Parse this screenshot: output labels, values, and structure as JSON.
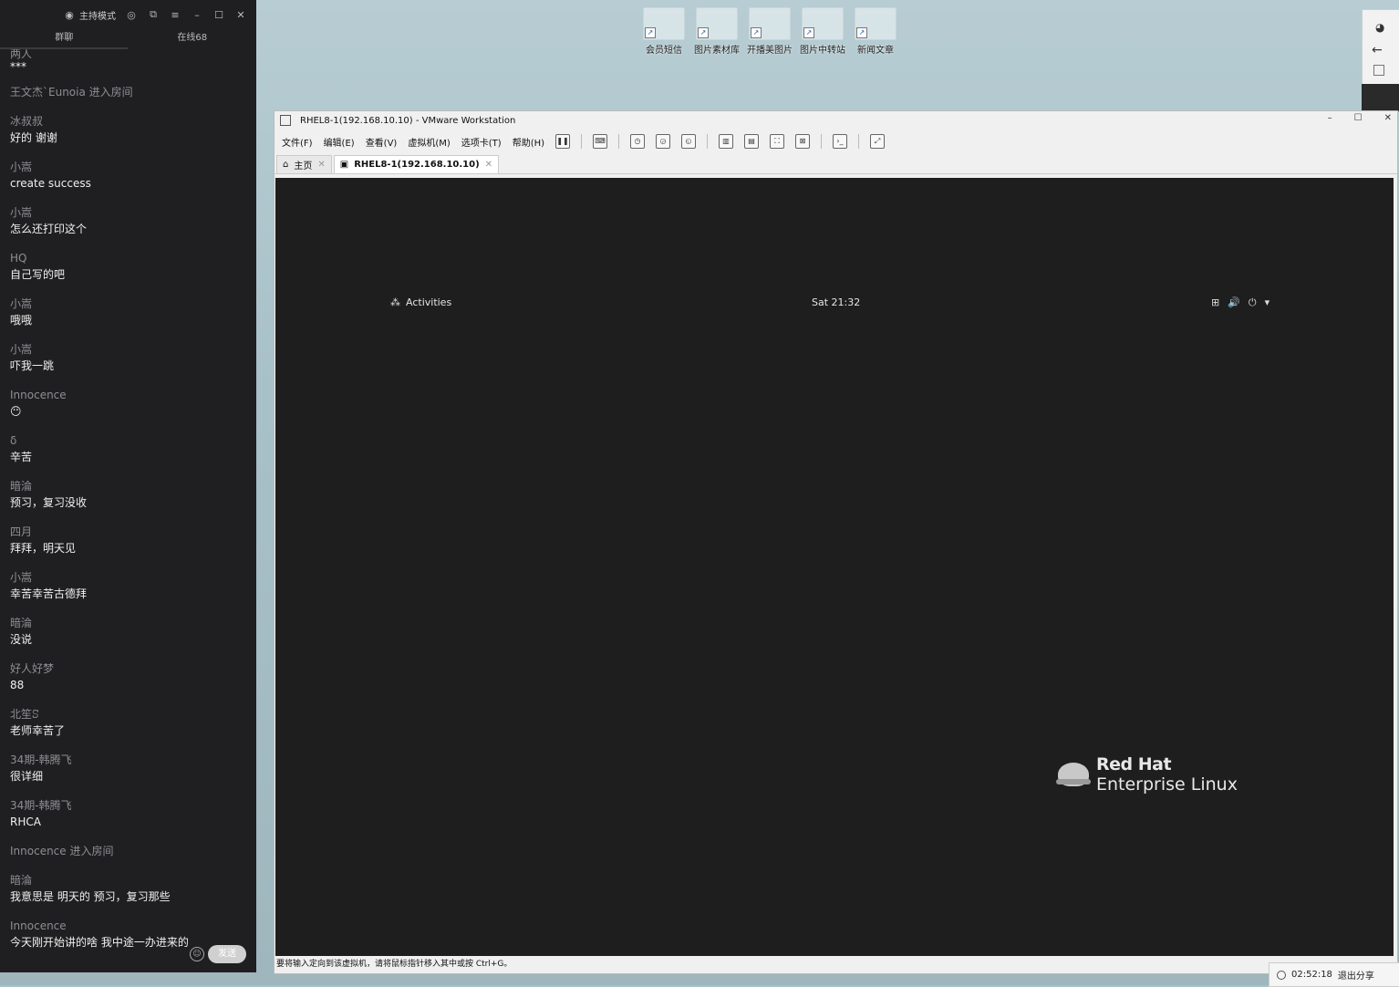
{
  "desktop": {
    "icons": [
      {
        "label": "会员短信"
      },
      {
        "label": "图片素材库"
      },
      {
        "label": "开播美图片"
      },
      {
        "label": "图片中转站"
      },
      {
        "label": "新闻文章"
      }
    ]
  },
  "chat": {
    "host_mode_label": "主持模式",
    "tabs": [
      {
        "label": "群聊"
      },
      {
        "label": "在线68"
      }
    ],
    "messages": [
      {
        "user": "两人",
        "text": "***"
      },
      {
        "system": "王文杰`Eunoia 进入房间"
      },
      {
        "user": "冰叔叔",
        "text": "好的 谢谢"
      },
      {
        "user": "小嵩",
        "text": "create success"
      },
      {
        "user": "小嵩",
        "text": "怎么还打印这个"
      },
      {
        "user": "HQ",
        "text": "自己写的吧"
      },
      {
        "user": "小嵩",
        "text": "哦哦"
      },
      {
        "user": "小嵩",
        "text": "吓我一跳"
      },
      {
        "user": "Innocence",
        "text": "😶"
      },
      {
        "user": "δ",
        "text": "辛苦"
      },
      {
        "user": "暗淪",
        "text": "预习，复习没收"
      },
      {
        "user": "四月",
        "text": "拜拜，明天见"
      },
      {
        "user": "小嵩",
        "text": "幸苦幸苦古德拜"
      },
      {
        "user": "暗淪",
        "text": "没说"
      },
      {
        "user": "好人好梦",
        "text": "88"
      },
      {
        "user": "北笙ꕶ",
        "text": "老师幸苦了"
      },
      {
        "user": "34期-韩腾飞",
        "text": "很详细"
      },
      {
        "user": "34期-韩腾飞",
        "text": "RHCA"
      },
      {
        "system": "Innocence 进入房间"
      },
      {
        "user": "暗淪",
        "text": "我意思是 明天的 预习，复习那些"
      },
      {
        "user": "Innocence",
        "text": "今天刚开始讲的啥 我中途一办进来的"
      }
    ],
    "send_label": "发送"
  },
  "vmware": {
    "title": "RHEL8-1(192.168.10.10) - VMware Workstation",
    "menu": [
      "文件(F)",
      "编辑(E)",
      "查看(V)",
      "虚拟机(M)",
      "选项卡(T)",
      "帮助(H)"
    ],
    "tabs": [
      {
        "label": "主页"
      },
      {
        "label": "RHEL8-1(192.168.10.10)"
      }
    ],
    "status_text": "要将输入定向到该虚拟机，请将鼠标指针移入其中或按 Ctrl+G。"
  },
  "guest": {
    "activities_label": "Activities",
    "clock": "Sat 21:32",
    "brand_line1": "Red Hat",
    "brand_line2": "Enterprise Linux"
  },
  "share_bar": {
    "timer": "02:52:18",
    "exit_label": "退出分享"
  }
}
